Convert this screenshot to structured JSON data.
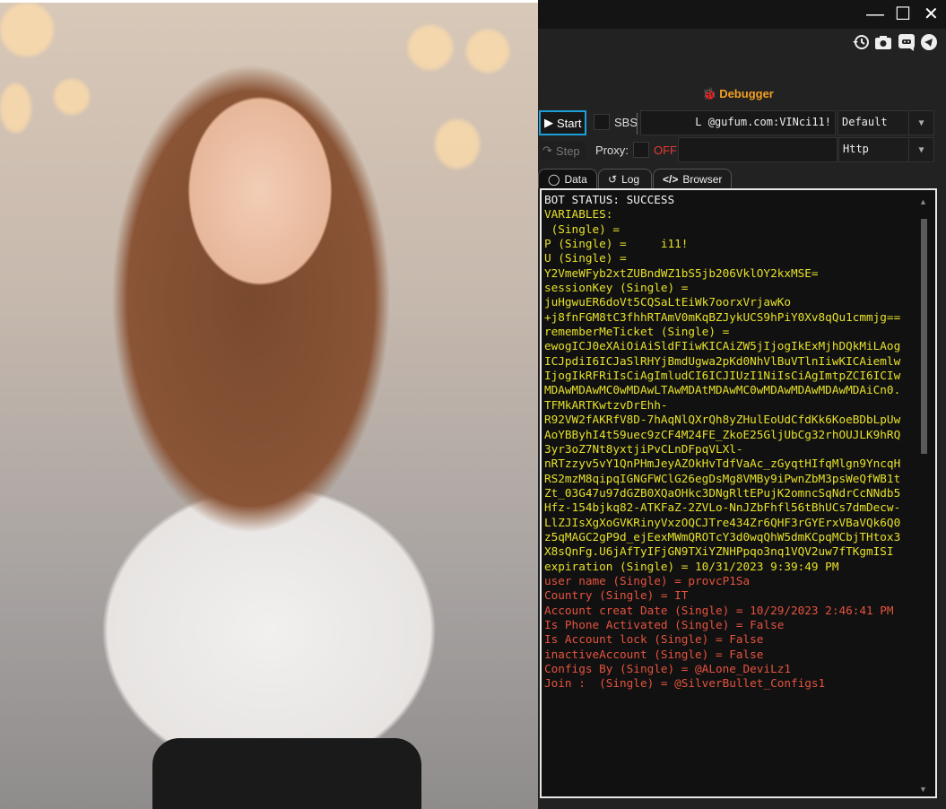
{
  "window": {
    "minimize": "—",
    "maximize": "☐",
    "close": "✕"
  },
  "toolbar_icons": [
    "history-icon",
    "camera-icon",
    "discord-icon",
    "telegram-icon"
  ],
  "debugger": {
    "title": "Debugger"
  },
  "controls": {
    "start_label": "Start",
    "step_label": "Step",
    "sbs_label": "SBS",
    "proxy_label": "Proxy:",
    "proxy_state": "OFF",
    "data_input": "L            @gufum.com:VINci11!",
    "proxy_input": "",
    "config_select": "Default",
    "proxy_type_select": "Http"
  },
  "tabs": [
    {
      "label": "Data"
    },
    {
      "label": "Log"
    },
    {
      "label": "Browser"
    }
  ],
  "console": {
    "lines": [
      {
        "text": "BOT STATUS: SUCCESS",
        "color": "white"
      },
      {
        "text": "VARIABLES:",
        "color": "yellow"
      },
      {
        "text": " (Single) =",
        "color": "yellow"
      },
      {
        "text": "P (Single) =     i11!",
        "color": "yellow"
      },
      {
        "text": "U (Single) =",
        "color": "yellow"
      },
      {
        "text": "Y2VmeWFyb2xtZUBndWZ1bS5jb206VklOY2kxMSE=",
        "color": "yellow"
      },
      {
        "text": "sessionKey (Single) =",
        "color": "yellow"
      },
      {
        "text": "juHgwuER6doVt5CQSaLtEiWk7oorxVrjawKo",
        "color": "yellow"
      },
      {
        "text": "+j8fnFGM8tC3fhhRTAmV0mKqBZJykUCS9hPiY0Xv8qQu1cmmjg==",
        "color": "yellow"
      },
      {
        "text": "rememberMeTicket (Single) =",
        "color": "yellow"
      },
      {
        "text": "ewogICJ0eXAiOiAiSldFIiwKICAiZW5jIjogIkExMjhDQkMiLAog",
        "color": "yellow"
      },
      {
        "text": "ICJpdiI6ICJaSlRHYjBmdUgwa2pKd0NhVlBuVTlnIiwKICAiemlw",
        "color": "yellow"
      },
      {
        "text": "IjogIkRFRiIsCiAgImludCI6ICJIUzI1NiIsCiAgImtpZCI6ICIw",
        "color": "yellow"
      },
      {
        "text": "MDAwMDAwMC0wMDAwLTAwMDAtMDAwMC0wMDAwMDAwMDAwMDAiCn0.",
        "color": "yellow"
      },
      {
        "text": "TFMkARTKwtzvDrEhh-",
        "color": "yellow"
      },
      {
        "text": "R92VW2fAKRfV8D-7hAqNlQXrQh8yZHulEoUdCfdKk6KoeBDbLpUw",
        "color": "yellow"
      },
      {
        "text": "AoYBByhI4t59uec9zCF4M24FE_ZkoE25GljUbCg32rhOUJLK9hRQ",
        "color": "yellow"
      },
      {
        "text": "3yr3oZ7Nt8yxtjiPvCLnDFpqVLXl-",
        "color": "yellow"
      },
      {
        "text": "nRTzzyv5vY1QnPHmJeyAZOkHvTdfVaAc_zGyqtHIfqMlgn9YncqH",
        "color": "yellow"
      },
      {
        "text": "RS2mzM8qipqIGNGFWClG26egDsMg8VMBy9iPwnZbM3psWeQfWB1t",
        "color": "yellow"
      },
      {
        "text": "Zt_03G47u97dGZB0XQaOHkc3DNgRltEPujK2omncSqNdrCcNNdb5",
        "color": "yellow"
      },
      {
        "text": "Hfz-154bjkq82-ATKFaZ-2ZVLo-NnJZbFhfl56tBhUCs7dmDecw-",
        "color": "yellow"
      },
      {
        "text": "LlZJIsXgXoGVKRinyVxzOQCJTre434Zr6QHF3rGYErxVBaVQk6Q0",
        "color": "yellow"
      },
      {
        "text": "z5qMAGC2gP9d_ejEexMWmQROTcY3d0wqQhW5dmKCpqMCbjTHtox3",
        "color": "yellow"
      },
      {
        "text": "X8sQnFg.U6jAfTyIFjGN9TXiYZNHPpqo3nq1VQV2uw7fTKgmISI",
        "color": "yellow"
      },
      {
        "text": "expiration (Single) = 10/31/2023 9:39:49 PM",
        "color": "yellow"
      },
      {
        "text": "user name (Single) = provcP1Sa",
        "color": "red"
      },
      {
        "text": "Country (Single) = IT",
        "color": "red"
      },
      {
        "text": "Account creat Date (Single) = 10/29/2023 2:46:41 PM",
        "color": "red"
      },
      {
        "text": "Is Phone Activated (Single) = False",
        "color": "red"
      },
      {
        "text": "Is Account lock (Single) = False",
        "color": "red"
      },
      {
        "text": "inactiveAccount (Single) = False",
        "color": "red"
      },
      {
        "text": "Configs By (Single) = @ALone_DeviLz1",
        "color": "red"
      },
      {
        "text": "Join :  (Single) = @SilverBullet_Configs1",
        "color": "red"
      }
    ]
  },
  "colors": {
    "accent": "#1e9fd8",
    "debugger": "#f0a020",
    "yellow": "#e6e02a",
    "red": "#e5533f",
    "off": "#e53935"
  }
}
